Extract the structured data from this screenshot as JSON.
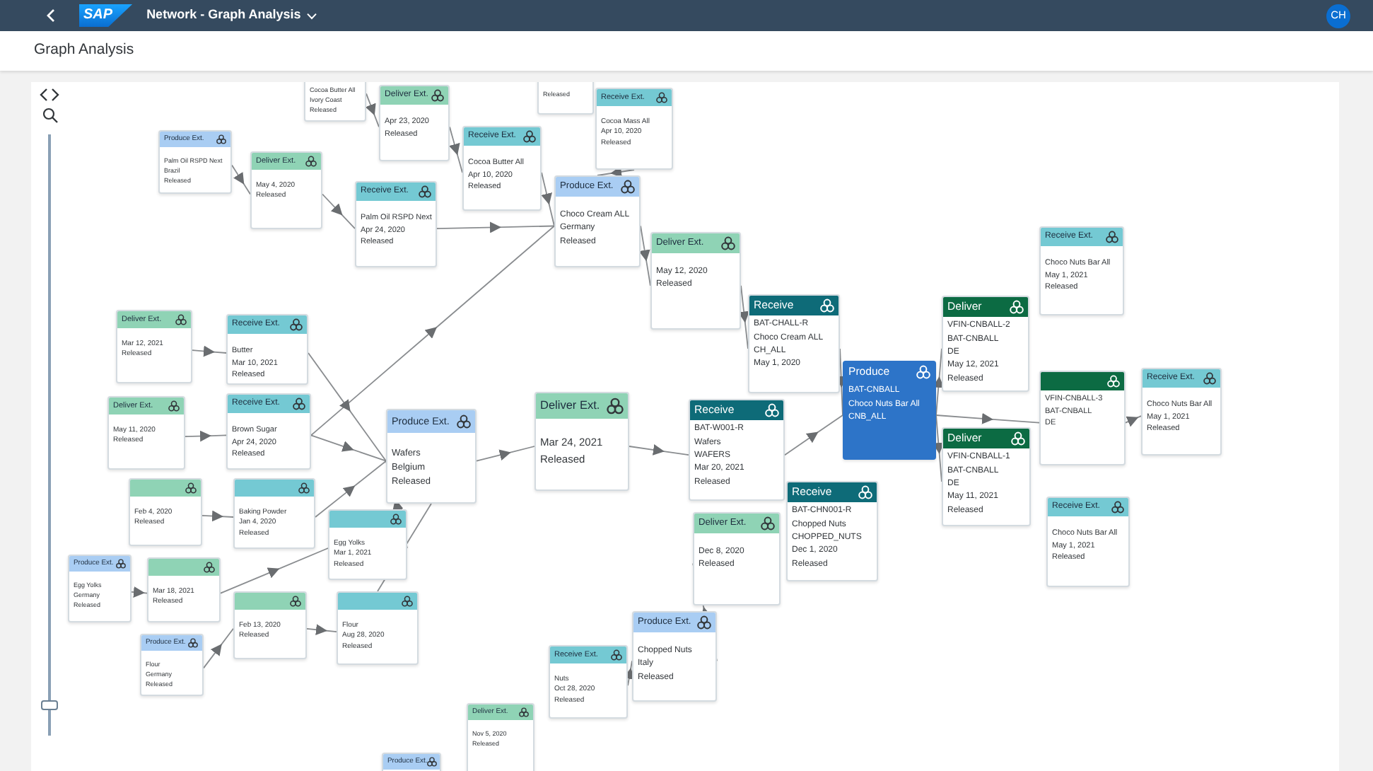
{
  "shell": {
    "logo": "SAP",
    "title": "Network - Graph Analysis",
    "avatar": "CH"
  },
  "page": {
    "title": "Graph Analysis"
  },
  "zoom": {
    "level": 0.05
  },
  "nodes": [
    {
      "kind": "produce-ext",
      "lines": [
        "Cocoa Butter All",
        "Ivory Coast",
        "Released"
      ],
      "selected": false
    },
    {
      "kind": "deliver-ext",
      "title": "Deliver Ext.",
      "lines": [
        "Apr 23, 2020",
        "Released"
      ],
      "selected": false
    },
    {
      "kind": "deliver-ext",
      "lines": [
        "Released"
      ],
      "selected": false
    },
    {
      "kind": "receive-ext",
      "title": "Receive Ext.",
      "lines": [
        "Cocoa Mass All",
        "Apr 10, 2020",
        "Released"
      ],
      "selected": false
    },
    {
      "kind": "produce-ext",
      "title": "Produce Ext.",
      "lines": [
        "Palm Oil RSPD Next",
        "Brazil",
        "Released"
      ],
      "selected": false
    },
    {
      "kind": "receive-ext",
      "title": "Receive Ext.",
      "lines": [
        "Cocoa Butter All",
        "Apr 10, 2020",
        "Released"
      ],
      "selected": false
    },
    {
      "kind": "deliver-ext",
      "title": "Deliver Ext.",
      "lines": [
        "May 4, 2020",
        "Released"
      ],
      "selected": false
    },
    {
      "kind": "receive-ext",
      "title": "Receive Ext.",
      "lines": [
        "Palm Oil RSPD Next",
        "Apr 24, 2020",
        "Released"
      ],
      "selected": false
    },
    {
      "kind": "produce-ext",
      "title": "Produce Ext.",
      "lines": [
        "Choco Cream ALL",
        "Germany",
        "Released"
      ],
      "selected": false
    },
    {
      "kind": "deliver-ext",
      "title": "Deliver Ext.",
      "lines": [
        "May 12, 2020",
        "Released"
      ],
      "selected": false
    },
    {
      "kind": "receive-ext",
      "title": "Receive Ext.",
      "lines": [
        "Choco Nuts Bar All",
        "May 1, 2021",
        "Released"
      ],
      "selected": false
    },
    {
      "kind": "receive",
      "title": "Receive",
      "lines": [
        "BAT-CHALL-R",
        "Choco Cream ALL",
        "CH_ALL",
        "May 1, 2020"
      ],
      "selected": false
    },
    {
      "kind": "deliver",
      "title": "Deliver",
      "lines": [
        "VFIN-CNBALL-2",
        "BAT-CNBALL",
        "DE",
        "May 12, 2021",
        "Released"
      ],
      "selected": false
    },
    {
      "kind": "deliver-ext",
      "title": "Deliver Ext.",
      "lines": [
        "Mar 12, 2021",
        "Released"
      ],
      "selected": false
    },
    {
      "kind": "receive-ext",
      "title": "Receive Ext.",
      "lines": [
        "Butter",
        "Mar 10, 2021",
        "Released"
      ],
      "selected": false
    },
    {
      "kind": "produce",
      "title": "Produce",
      "lines": [
        "BAT-CNBALL",
        "Choco Nuts Bar All",
        "CNB_ALL"
      ],
      "selected": true
    },
    {
      "kind": "deliver",
      "lines": [
        "VFIN-CNBALL-3",
        "BAT-CNBALL",
        "DE"
      ],
      "selected": false
    },
    {
      "kind": "receive-ext",
      "title": "Receive Ext.",
      "lines": [
        "Choco Nuts Bar All",
        "May 1, 2021",
        "Released"
      ],
      "selected": false
    },
    {
      "kind": "deliver-ext",
      "title": "Deliver Ext.",
      "lines": [
        "May 11, 2020",
        "Released"
      ],
      "selected": false
    },
    {
      "kind": "receive-ext",
      "title": "Receive Ext.",
      "lines": [
        "Brown Sugar",
        "Apr 24, 2020",
        "Released"
      ],
      "selected": false
    },
    {
      "kind": "produce-ext",
      "title": "Produce Ext.",
      "lines": [
        "Wafers",
        "Belgium",
        "Released"
      ],
      "selected": false
    },
    {
      "kind": "deliver-ext",
      "title": "Deliver Ext.",
      "lines": [
        "Mar 24, 2021",
        "Released"
      ],
      "selected": false
    },
    {
      "kind": "receive",
      "title": "Receive",
      "lines": [
        "BAT-W001-R",
        "Wafers",
        "WAFERS",
        "Mar 20, 2021",
        "Released"
      ],
      "selected": false
    },
    {
      "kind": "deliver",
      "title": "Deliver",
      "lines": [
        "VFIN-CNBALL-1",
        "BAT-CNBALL",
        "DE",
        "May 11, 2021",
        "Released"
      ],
      "selected": false
    },
    {
      "kind": "deliver-ext",
      "lines": [
        "Feb 4, 2020",
        "Released"
      ],
      "selected": false
    },
    {
      "kind": "receive-ext",
      "lines": [
        "Baking Powder",
        "Jan 4, 2020",
        "Released"
      ],
      "selected": false
    },
    {
      "kind": "receive",
      "title": "Receive",
      "lines": [
        "BAT-CHN001-R",
        "Chopped Nuts",
        "CHOPPED_NUTS",
        "Dec 1, 2020",
        "Released"
      ],
      "selected": false
    },
    {
      "kind": "receive-ext",
      "title": "Receive Ext.",
      "lines": [
        "Choco Nuts Bar All",
        "May 1, 2021",
        "Released"
      ],
      "selected": false
    },
    {
      "kind": "receive-ext",
      "lines": [
        "Egg Yolks",
        "Mar 1, 2021",
        "Released"
      ],
      "selected": false
    },
    {
      "kind": "deliver-ext",
      "title": "Deliver Ext.",
      "lines": [
        "Dec 8, 2020",
        "Released"
      ],
      "selected": false
    },
    {
      "kind": "produce-ext",
      "title": "Produce Ext.",
      "lines": [
        "Egg Yolks",
        "Germany",
        "Released"
      ],
      "selected": false
    },
    {
      "kind": "deliver-ext",
      "lines": [
        "Mar 18, 2021",
        "Released"
      ],
      "selected": false
    },
    {
      "kind": "deliver-ext",
      "lines": [
        "Feb 13, 2020",
        "Released"
      ],
      "selected": false
    },
    {
      "kind": "receive-ext",
      "lines": [
        "Flour",
        "Aug 28, 2020",
        "Released"
      ],
      "selected": false
    },
    {
      "kind": "produce-ext",
      "title": "Produce Ext.",
      "lines": [
        "Chopped Nuts",
        "Italy",
        "Released"
      ],
      "selected": false
    },
    {
      "kind": "produce-ext",
      "title": "Produce Ext.",
      "lines": [
        "Flour",
        "Germany",
        "Released"
      ],
      "selected": false
    },
    {
      "kind": "receive-ext",
      "title": "Receive Ext.",
      "lines": [
        "Nuts",
        "Oct 28, 2020",
        "Released"
      ],
      "selected": false
    },
    {
      "kind": "deliver-ext",
      "title": "Deliver Ext.",
      "lines": [
        "Nov 5, 2020",
        "Released"
      ],
      "selected": false
    },
    {
      "kind": "produce-ext",
      "title": "Produce Ext.",
      "selected": false
    }
  ]
}
